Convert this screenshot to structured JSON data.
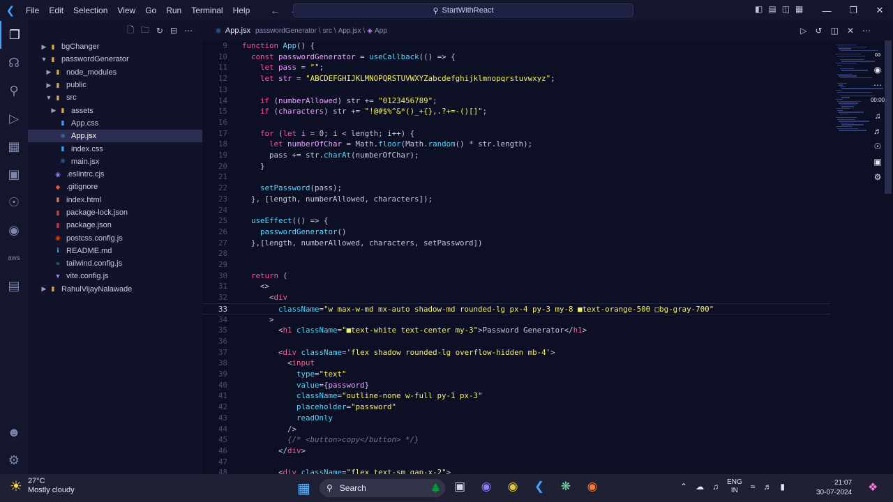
{
  "titlebar": {
    "menu": [
      "File",
      "Edit",
      "Selection",
      "View",
      "Go",
      "Run",
      "Terminal",
      "Help"
    ],
    "command_center": "StartWithReact"
  },
  "explorer": {
    "items": [
      {
        "label": "bgChanger",
        "depth": 1,
        "type": "folder",
        "open": false
      },
      {
        "label": "passwordGenerator",
        "depth": 1,
        "type": "folder",
        "open": true
      },
      {
        "label": "node_modules",
        "depth": 2,
        "type": "folder",
        "open": false
      },
      {
        "label": "public",
        "depth": 2,
        "type": "folder",
        "open": false
      },
      {
        "label": "src",
        "depth": 2,
        "type": "folder",
        "open": true
      },
      {
        "label": "assets",
        "depth": 3,
        "type": "folder",
        "open": false
      },
      {
        "label": "App.css",
        "depth": 3,
        "type": "css"
      },
      {
        "label": "App.jsx",
        "depth": 3,
        "type": "jsx",
        "selected": true
      },
      {
        "label": "index.css",
        "depth": 3,
        "type": "css"
      },
      {
        "label": "main.jsx",
        "depth": 3,
        "type": "jsx"
      },
      {
        "label": ".eslintrc.cjs",
        "depth": 2,
        "type": "eslint"
      },
      {
        "label": ".gitignore",
        "depth": 2,
        "type": "git"
      },
      {
        "label": "index.html",
        "depth": 2,
        "type": "html"
      },
      {
        "label": "package-lock.json",
        "depth": 2,
        "type": "npm"
      },
      {
        "label": "package.json",
        "depth": 2,
        "type": "npm"
      },
      {
        "label": "postcss.config.js",
        "depth": 2,
        "type": "postcss"
      },
      {
        "label": "README.md",
        "depth": 2,
        "type": "md"
      },
      {
        "label": "tailwind.config.js",
        "depth": 2,
        "type": "tailwind"
      },
      {
        "label": "vite.config.js",
        "depth": 2,
        "type": "vite"
      },
      {
        "label": "RahulVijayNalawade",
        "depth": 1,
        "type": "folder",
        "open": false
      }
    ]
  },
  "tab": {
    "filename": "App.jsx",
    "breadcrumb": [
      "passwordGenerator",
      "src",
      "App.jsx",
      "App"
    ],
    "breadcrumb_sep": "\\"
  },
  "editor": {
    "current_line": "33",
    "lines": [
      {
        "n": "9",
        "t": [
          [
            "kw",
            "function "
          ],
          [
            "fn",
            "App"
          ],
          [
            "punc",
            "() {"
          ]
        ]
      },
      {
        "n": "10",
        "t": [
          [
            "punc",
            "  "
          ],
          [
            "kw",
            "const "
          ],
          [
            "var",
            "passwordGenerator"
          ],
          [
            "punc",
            " = "
          ],
          [
            "fn",
            "useCallback"
          ],
          [
            "punc",
            "(() => {"
          ]
        ]
      },
      {
        "n": "11",
        "t": [
          [
            "punc",
            "    "
          ],
          [
            "kw",
            "let "
          ],
          [
            "var",
            "pass"
          ],
          [
            "punc",
            " = "
          ],
          [
            "str",
            "\"\""
          ],
          [
            "punc",
            ";"
          ]
        ]
      },
      {
        "n": "12",
        "t": [
          [
            "punc",
            "    "
          ],
          [
            "kw",
            "let "
          ],
          [
            "var",
            "str"
          ],
          [
            "punc",
            " = "
          ],
          [
            "str",
            "\"ABCDEFGHIJKLMNOPQRSTUVWXYZabcdefghijklmnopqrstuvwxyz\""
          ],
          [
            "punc",
            ";"
          ]
        ]
      },
      {
        "n": "13",
        "t": []
      },
      {
        "n": "14",
        "t": [
          [
            "punc",
            "    "
          ],
          [
            "kw",
            "if "
          ],
          [
            "punc",
            "("
          ],
          [
            "var",
            "numberAllowed"
          ],
          [
            "punc",
            ") str += "
          ],
          [
            "str",
            "\"0123456789\""
          ],
          [
            "punc",
            ";"
          ]
        ]
      },
      {
        "n": "15",
        "t": [
          [
            "punc",
            "    "
          ],
          [
            "kw",
            "if "
          ],
          [
            "punc",
            "("
          ],
          [
            "var",
            "characters"
          ],
          [
            "punc",
            ") str += "
          ],
          [
            "str",
            "\"!@#$%^&*()_+{},.?+=-()[]\""
          ],
          [
            "punc",
            ";"
          ]
        ]
      },
      {
        "n": "16",
        "t": []
      },
      {
        "n": "17",
        "t": [
          [
            "punc",
            "    "
          ],
          [
            "kw",
            "for "
          ],
          [
            "punc",
            "("
          ],
          [
            "kw",
            "let "
          ],
          [
            "var",
            "i"
          ],
          [
            "punc",
            " = 0; i < length; i++) {"
          ]
        ]
      },
      {
        "n": "18",
        "t": [
          [
            "punc",
            "      "
          ],
          [
            "kw",
            "let "
          ],
          [
            "var",
            "numberOfChar"
          ],
          [
            "punc",
            " = Math."
          ],
          [
            "fn",
            "floor"
          ],
          [
            "punc",
            "(Math."
          ],
          [
            "fn",
            "random"
          ],
          [
            "punc",
            "() * str.length);"
          ]
        ]
      },
      {
        "n": "19",
        "t": [
          [
            "punc",
            "      pass += str."
          ],
          [
            "fn",
            "charAt"
          ],
          [
            "punc",
            "(numberOfChar);"
          ]
        ]
      },
      {
        "n": "20",
        "t": [
          [
            "punc",
            "    }"
          ]
        ]
      },
      {
        "n": "21",
        "t": []
      },
      {
        "n": "22",
        "t": [
          [
            "punc",
            "    "
          ],
          [
            "fn",
            "setPassword"
          ],
          [
            "punc",
            "(pass);"
          ]
        ]
      },
      {
        "n": "23",
        "t": [
          [
            "punc",
            "  }, [length, numberAllowed, characters]);"
          ]
        ]
      },
      {
        "n": "24",
        "t": []
      },
      {
        "n": "25",
        "t": [
          [
            "punc",
            "  "
          ],
          [
            "fn",
            "useEffect"
          ],
          [
            "punc",
            "(() => {"
          ]
        ]
      },
      {
        "n": "26",
        "t": [
          [
            "punc",
            "    "
          ],
          [
            "fn",
            "passwordGenerator"
          ],
          [
            "punc",
            "()"
          ]
        ]
      },
      {
        "n": "27",
        "t": [
          [
            "punc",
            "  },[length, numberAllowed, characters, setPassword])"
          ]
        ]
      },
      {
        "n": "28",
        "t": []
      },
      {
        "n": "29",
        "t": []
      },
      {
        "n": "30",
        "t": [
          [
            "punc",
            "  "
          ],
          [
            "kw",
            "return "
          ],
          [
            "punc",
            "("
          ]
        ]
      },
      {
        "n": "31",
        "t": [
          [
            "punc",
            "    <>"
          ]
        ]
      },
      {
        "n": "32",
        "t": [
          [
            "punc",
            "      <"
          ],
          [
            "tag",
            "div"
          ]
        ]
      },
      {
        "n": "33",
        "t": [
          [
            "punc",
            "        "
          ],
          [
            "attr",
            "className"
          ],
          [
            "punc",
            "="
          ],
          [
            "str",
            "\"w max-w-md mx-auto shadow-md rounded-lg px-4 py-3 my-8 ■text-orange-500 □bg-gray-700\""
          ]
        ]
      },
      {
        "n": "34",
        "t": [
          [
            "punc",
            "      >"
          ]
        ]
      },
      {
        "n": "35",
        "t": [
          [
            "punc",
            "        <"
          ],
          [
            "tag",
            "h1 "
          ],
          [
            "attr",
            "className"
          ],
          [
            "punc",
            "="
          ],
          [
            "str",
            "\"■text-white text-center my-3\""
          ],
          [
            "punc",
            ">Password Generator</"
          ],
          [
            "tag",
            "h1"
          ],
          [
            "punc",
            ">"
          ]
        ]
      },
      {
        "n": "36",
        "t": []
      },
      {
        "n": "37",
        "t": [
          [
            "punc",
            "        <"
          ],
          [
            "tag",
            "div "
          ],
          [
            "attr",
            "className"
          ],
          [
            "punc",
            "="
          ],
          [
            "str",
            "'flex shadow rounded-lg overflow-hidden mb-4'"
          ],
          [
            "punc",
            ">"
          ]
        ]
      },
      {
        "n": "38",
        "t": [
          [
            "punc",
            "          <"
          ],
          [
            "tag",
            "input"
          ]
        ]
      },
      {
        "n": "39",
        "t": [
          [
            "punc",
            "            "
          ],
          [
            "attr",
            "type"
          ],
          [
            "punc",
            "="
          ],
          [
            "str",
            "\"text\""
          ]
        ]
      },
      {
        "n": "40",
        "t": [
          [
            "punc",
            "            "
          ],
          [
            "attr",
            "value"
          ],
          [
            "punc",
            "={"
          ],
          [
            "var",
            "password"
          ],
          [
            "punc",
            "}"
          ]
        ]
      },
      {
        "n": "41",
        "t": [
          [
            "punc",
            "            "
          ],
          [
            "attr",
            "className"
          ],
          [
            "punc",
            "="
          ],
          [
            "str",
            "\"outline-none w-full py-1 px-3\""
          ]
        ]
      },
      {
        "n": "42",
        "t": [
          [
            "punc",
            "            "
          ],
          [
            "attr",
            "placeholder"
          ],
          [
            "punc",
            "="
          ],
          [
            "str",
            "\"password\""
          ]
        ]
      },
      {
        "n": "43",
        "t": [
          [
            "punc",
            "            "
          ],
          [
            "attr",
            "readOnly"
          ]
        ]
      },
      {
        "n": "44",
        "t": [
          [
            "punc",
            "          />"
          ]
        ]
      },
      {
        "n": "45",
        "t": [
          [
            "punc",
            "          "
          ],
          [
            "com",
            "{/* <button>copy</button> */}"
          ]
        ]
      },
      {
        "n": "46",
        "t": [
          [
            "punc",
            "        </"
          ],
          [
            "tag",
            "div"
          ],
          [
            "punc",
            ">"
          ]
        ]
      },
      {
        "n": "47",
        "t": []
      },
      {
        "n": "48",
        "t": [
          [
            "punc",
            "        <"
          ],
          [
            "tag",
            "div "
          ],
          [
            "attr",
            "className"
          ],
          [
            "punc",
            "="
          ],
          [
            "str",
            "\"flex text-sm gap-x-2\""
          ],
          [
            "punc",
            ">"
          ]
        ]
      }
    ]
  },
  "taskbar": {
    "weather_temp": "27°C",
    "weather_desc": "Mostly cloudy",
    "search_label": "Search",
    "lang_top": "ENG",
    "lang_bottom": "IN",
    "time": "21:07",
    "date": "30-07-2024"
  },
  "colors": {
    "accent": "#3ea3ff",
    "editor_bg": "#0d0f24",
    "sidebar_bg": "#11132b",
    "keyword": "#ff4fa0",
    "function": "#57d7ff",
    "string": "#f4f06a"
  }
}
